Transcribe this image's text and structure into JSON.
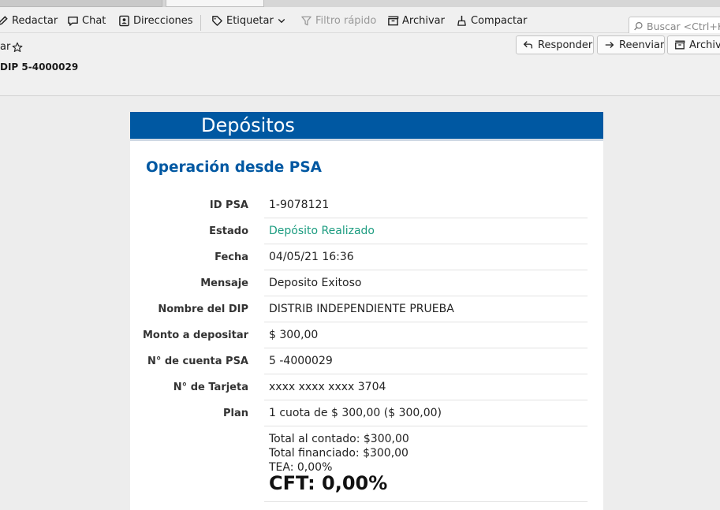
{
  "toolbar": {
    "compose": "Redactar",
    "chat": "Chat",
    "addresses": "Direcciones",
    "tag": "Etiquetar",
    "quick_filter": "Filtro rápido",
    "archive": "Archivar",
    "compact": "Compactar",
    "search_placeholder": "Buscar <Ctrl+K>"
  },
  "header": {
    "from_fragment": "ar",
    "subject_fragment": "DIP 5-4000029",
    "reply": "Responder",
    "forward": "Reenviar",
    "archive": "Archivar"
  },
  "email": {
    "banner_title": "Depósitos",
    "section_title": "Operación desde PSA",
    "rows": [
      {
        "label": "ID PSA",
        "value": "1-9078121"
      },
      {
        "label": "Estado",
        "value": "Depósito Realizado"
      },
      {
        "label": "Fecha",
        "value": "04/05/21 16:36"
      },
      {
        "label": "Mensaje",
        "value": "Deposito Exitoso"
      },
      {
        "label": "Nombre del DIP",
        "value": "DISTRIB INDEPENDIENTE PRUEBA"
      },
      {
        "label": "Monto a depositar",
        "value": "$ 300,00"
      },
      {
        "label": "N° de cuenta PSA",
        "value": "5 -4000029"
      },
      {
        "label": "N° de Tarjeta",
        "value": "xxxx xxxx xxxx 3704"
      },
      {
        "label": "Plan",
        "value": "1 cuota de $ 300,00 ($ 300,00)"
      }
    ],
    "summary": {
      "total_cash": "Total al contado: $300,00",
      "total_financed": "Total financiado: $300,00",
      "tea": "TEA: 0,00%",
      "cft": "CFT: 0,00%"
    }
  },
  "colors": {
    "banner": "#0058a2",
    "title": "#0058a2",
    "status_green": "#1c9c80"
  }
}
